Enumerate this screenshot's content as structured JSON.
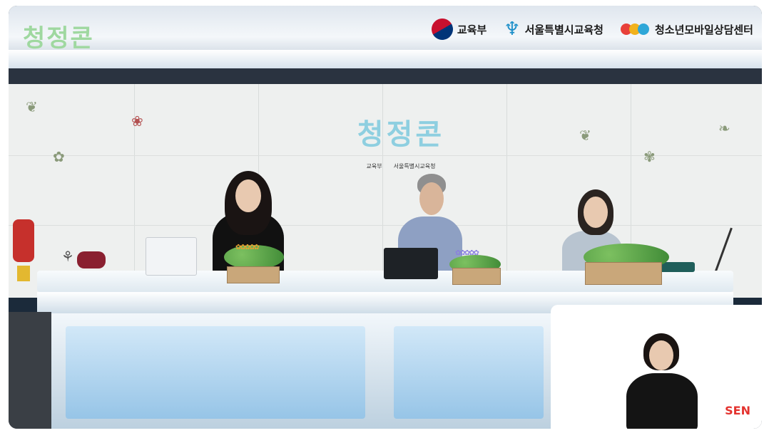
{
  "brand": {
    "name": "청정콘"
  },
  "top_logos": {
    "moe": "교육부",
    "seoul": "서울특별시교육청",
    "youth": "청소년모바일상담센터"
  },
  "backdrop": {
    "brand": "청정콘",
    "logos": [
      "교육부",
      "서울특별시교육청"
    ]
  },
  "broadcaster": "SEN",
  "colors": {
    "brand_blue": "#7ec7d8",
    "brand_green": "#9fd8a0",
    "sen_red": "#e4332f"
  },
  "icons": [
    "taeguk-icon",
    "seoul-edu-icon",
    "youth-center-dots-icon"
  ]
}
